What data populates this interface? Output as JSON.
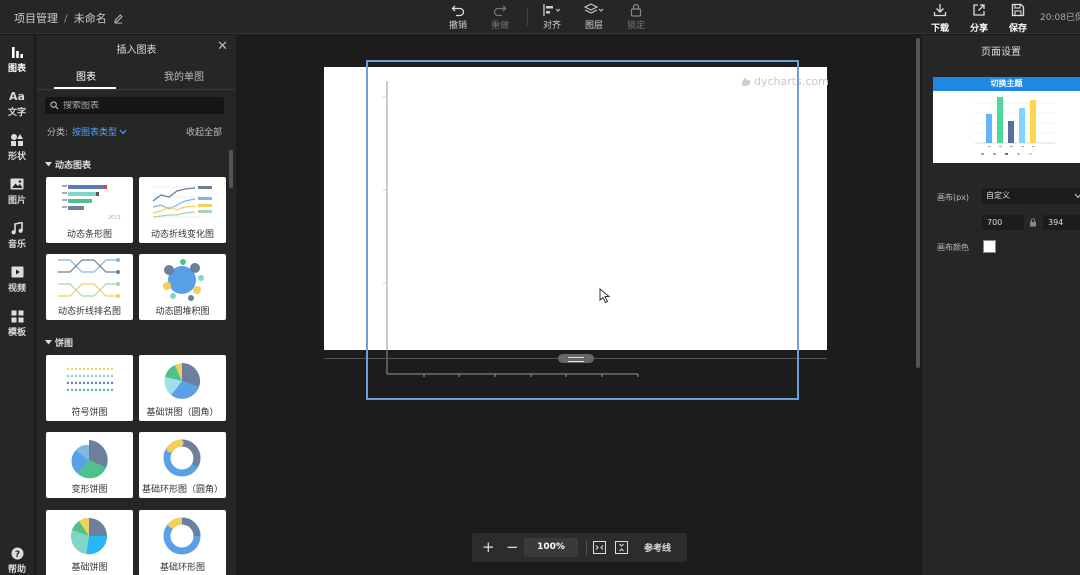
{
  "header": {
    "breadcrumb_project": "项目管理",
    "breadcrumb_sep": "/",
    "doc_name": "未命名",
    "undo": "撤销",
    "redo": "重做",
    "align": "对齐",
    "layer": "图层",
    "lock": "锁定",
    "download": "下载",
    "share": "分享",
    "save": "保存",
    "save_time": "20:08已保"
  },
  "rail": [
    {
      "label": "图表",
      "icon": "chart-icon"
    },
    {
      "label": "文字",
      "icon": "text-icon"
    },
    {
      "label": "形状",
      "icon": "shape-icon"
    },
    {
      "label": "图片",
      "icon": "image-icon"
    },
    {
      "label": "音乐",
      "icon": "music-icon"
    },
    {
      "label": "视频",
      "icon": "video-icon"
    },
    {
      "label": "模板",
      "icon": "template-icon"
    },
    {
      "label": "帮助",
      "icon": "help-icon"
    }
  ],
  "panel": {
    "title": "插入图表",
    "tabs": [
      "图表",
      "我的单图"
    ],
    "search_placeholder": "搜索图表",
    "filter_label": "分类:",
    "filter_value": "按图表类型",
    "collapse_all": "收起全部",
    "sections": [
      {
        "name": "动态图表",
        "items": [
          "动态条形图",
          "动态折线变化图",
          "动态折线排名图",
          "动态圆堆积图"
        ]
      },
      {
        "name": "饼图",
        "items": [
          "符号饼图",
          "基础饼图（圆角）",
          "变形饼图",
          "基础环形图（圆角）",
          "基础饼图",
          "基础环形图"
        ]
      }
    ]
  },
  "canvas": {
    "watermark": "dycharts.com",
    "zoom": "100%",
    "reference_lines": "参考线"
  },
  "right_panel": {
    "title": "页面设置",
    "theme_button": "切换主题",
    "canvas_label": "画布(px)",
    "canvas_preset": "自定义",
    "width": "700",
    "height": "394",
    "bg_label": "画布颜色",
    "bg_color": "#ffffff"
  },
  "colors": {
    "accent": "#4ea1ff",
    "selection": "#6b9fdc",
    "theme_header": "#1e88e5"
  }
}
